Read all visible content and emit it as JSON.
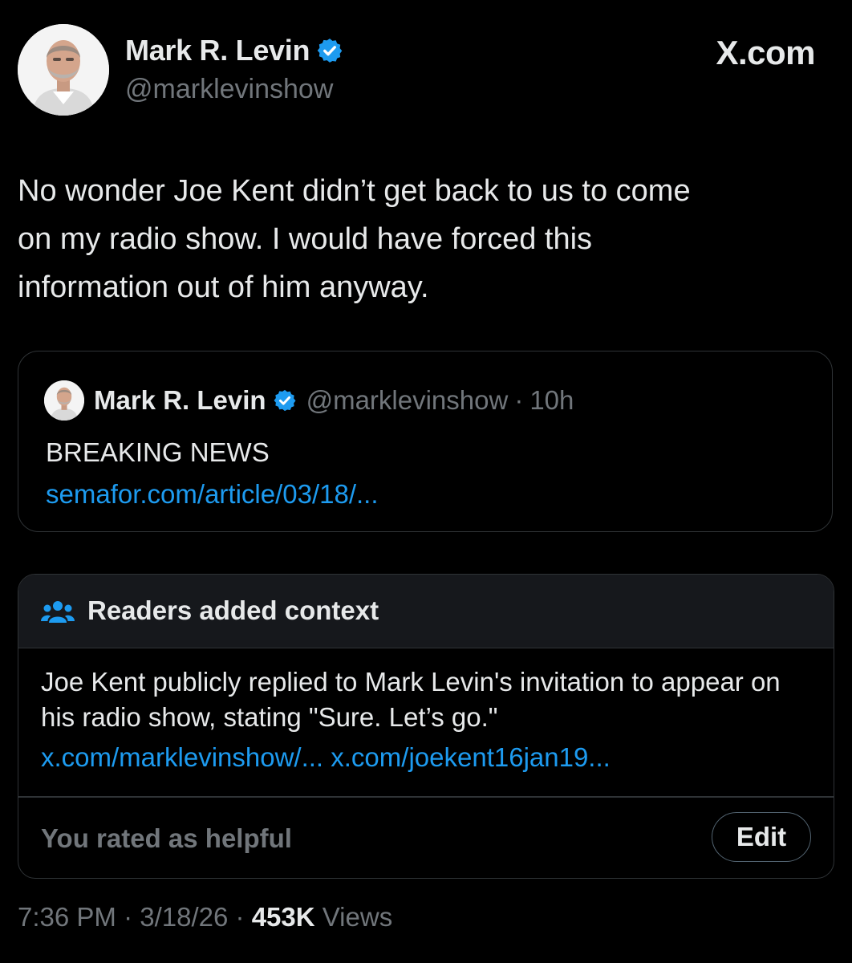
{
  "author": {
    "name": "Mark R. Levin",
    "handle": "@marklevinshow",
    "verified": true,
    "avatar_icon": "profile-photo"
  },
  "brand": {
    "label": "X.com"
  },
  "tweet": {
    "text": "No wonder Joe Kent didn’t get back to us to come\non my radio show.  I would have forced this\ninformation out of him anyway."
  },
  "quote_tweet": {
    "name": "Mark R. Levin",
    "handle": "@marklevinshow",
    "separator": "·",
    "time": "10h",
    "text": "BREAKING NEWS",
    "link": "semafor.com/article/03/18/..."
  },
  "community_note": {
    "icon": "people-icon",
    "title": "Readers added context",
    "body": "Joe Kent publicly replied to Mark Levin's invitation to appear on his radio show, stating \"Sure. Let’s go.\"",
    "links": [
      "x.com/marklevinshow/...",
      "x.com/joekent16jan19..."
    ],
    "rating": "You rated as helpful",
    "edit_label": "Edit"
  },
  "meta": {
    "time": "7:36 PM",
    "separator": "·",
    "date": "3/18/26",
    "views_count": "453K",
    "views_label": "Views"
  },
  "colors": {
    "background": "#000000",
    "text": "#e7e9ea",
    "secondary_text": "#71767b",
    "link": "#1d9bf0",
    "verified_badge": "#1d9bf0",
    "border": "#2f3336"
  }
}
